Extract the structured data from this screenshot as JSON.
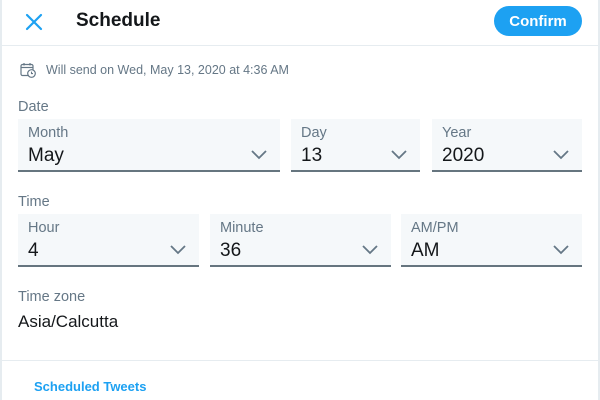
{
  "header": {
    "title": "Schedule",
    "confirm_label": "Confirm",
    "close_icon": "close-icon",
    "accent_color": "#1da1f2"
  },
  "send_info": {
    "text": "Will send on Wed, May 13, 2020 at 4:36 AM",
    "icon": "calendar-clock-icon"
  },
  "date": {
    "section_label": "Date",
    "month": {
      "label": "Month",
      "value": "May"
    },
    "day": {
      "label": "Day",
      "value": "13"
    },
    "year": {
      "label": "Year",
      "value": "2020"
    }
  },
  "time": {
    "section_label": "Time",
    "hour": {
      "label": "Hour",
      "value": "4"
    },
    "minute": {
      "label": "Minute",
      "value": "36"
    },
    "ampm": {
      "label": "AM/PM",
      "value": "AM"
    }
  },
  "timezone": {
    "label": "Time zone",
    "value": "Asia/Calcutta"
  },
  "footer": {
    "scheduled_link": "Scheduled Tweets"
  }
}
